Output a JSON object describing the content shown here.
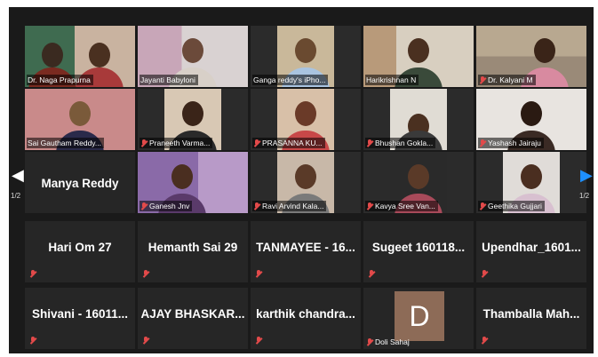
{
  "colors": {
    "stage_bg": "#1a1a1a",
    "tile_bg": "#262626",
    "muted_mic": "#e24a4a",
    "active_border": "#c9d93a",
    "nav_right_arrow": "#1e90ff",
    "avatar_bg": "#8d6b57"
  },
  "navigation": {
    "left": {
      "arrow_icon": "arrow-left-icon",
      "page": "1/2"
    },
    "right": {
      "arrow_icon": "arrow-right-icon",
      "page": "1/2"
    }
  },
  "participants": [
    {
      "name": "Dr. Naga Prapurna",
      "video": true,
      "muted": false
    },
    {
      "name": "Jayanti Babyloni",
      "video": true,
      "muted": false
    },
    {
      "name": "Ganga reddy's iPho...",
      "video": true,
      "muted": false
    },
    {
      "name": "Harikrishnan N",
      "video": true,
      "muted": false
    },
    {
      "name": "Dr. Kalyani M",
      "video": true,
      "muted": true
    },
    {
      "name": "Sai Gautham Reddy...",
      "video": true,
      "muted": false,
      "active_speaker": true
    },
    {
      "name": "Praneeth Varma...",
      "video": true,
      "muted": true
    },
    {
      "name": "PRASANNA KU...",
      "video": true,
      "muted": true
    },
    {
      "name": "Bhushan Gokla...",
      "video": true,
      "muted": true
    },
    {
      "name": "Yashash Jairaju",
      "video": true,
      "muted": true
    },
    {
      "name": "Manya Reddy",
      "video": false,
      "muted": false
    },
    {
      "name": "Ganesh Jnv",
      "video": true,
      "muted": true
    },
    {
      "name": "Ravi Arvind Kala...",
      "video": true,
      "muted": true
    },
    {
      "name": "Kavya Sree Van...",
      "video": true,
      "muted": true
    },
    {
      "name": "Geethika Gujjari",
      "video": true,
      "muted": true
    },
    {
      "name": "Hari Om 27",
      "video": false,
      "muted": true
    },
    {
      "name": "Hemanth Sai 29",
      "video": false,
      "muted": true
    },
    {
      "name": "TANMAYEE - 16...",
      "video": false,
      "muted": true
    },
    {
      "name": "Sugeet 160118...",
      "video": false,
      "muted": true
    },
    {
      "name": "Upendhar_1601...",
      "video": false,
      "muted": true
    },
    {
      "name": "Shivani - 16011...",
      "video": false,
      "muted": true
    },
    {
      "name": "AJAY BHASKAR...",
      "video": false,
      "muted": true
    },
    {
      "name": "karthik chandra...",
      "video": false,
      "muted": true
    },
    {
      "name": "Doli Sahaj",
      "video": false,
      "muted": true,
      "avatar_letter": "D"
    },
    {
      "name": "Thamballa Mah...",
      "video": false,
      "muted": true
    }
  ]
}
